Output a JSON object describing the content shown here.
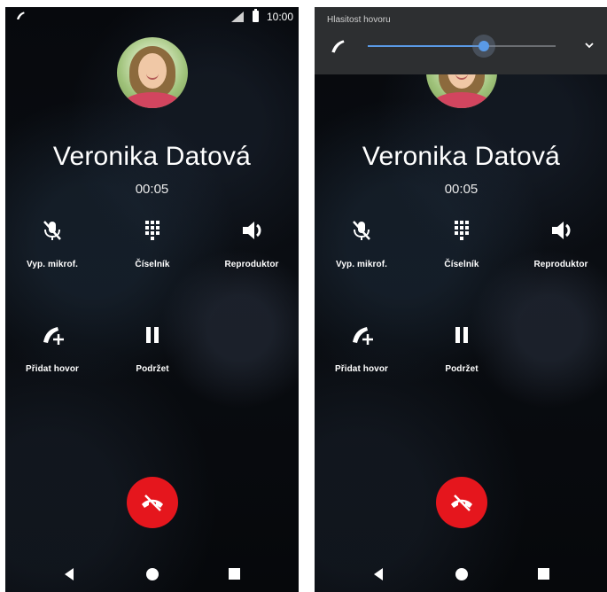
{
  "screens": [
    {
      "status": {
        "time": "10:00"
      },
      "caller": {
        "name": "Veronika Datová",
        "duration": "00:05"
      },
      "actions": {
        "mute": "Vyp. mikrof.",
        "keypad": "Číselník",
        "speaker": "Reproduktor",
        "add_call": "Přidat hovor",
        "hold": "Podržet"
      }
    },
    {
      "volume": {
        "title": "Hlasitost hovoru",
        "level": 0.62
      },
      "caller": {
        "name": "Veronika Datová",
        "duration": "00:05"
      },
      "actions": {
        "mute": "Vyp. mikrof.",
        "keypad": "Číselník",
        "speaker": "Reproduktor",
        "add_call": "Přidat hovor",
        "hold": "Podržet"
      }
    }
  ],
  "colors": {
    "end_call": "#e5161d",
    "accent": "#5a9ae6",
    "background": "#07090d"
  },
  "icons": [
    "phone-icon",
    "signal-icon",
    "battery-icon",
    "mic-off-icon",
    "dialpad-icon",
    "speaker-icon",
    "add-call-icon",
    "pause-icon",
    "end-call-icon",
    "back-icon",
    "home-icon",
    "recents-icon",
    "chevron-down-icon"
  ]
}
